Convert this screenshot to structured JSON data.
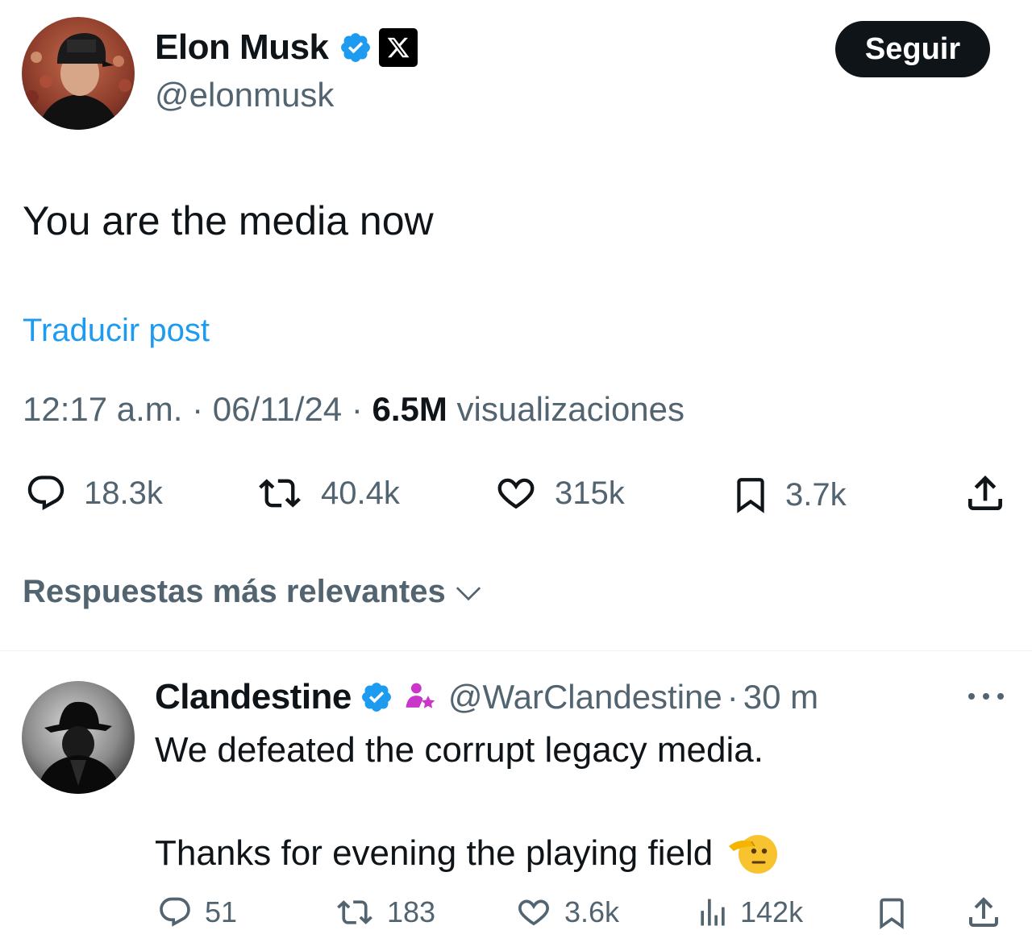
{
  "author": {
    "name": "Elon Musk",
    "handle": "@elonmusk",
    "verified": true,
    "affiliate_badge": "x-logo-icon"
  },
  "follow_button": {
    "label": "Seguir"
  },
  "post": {
    "text": "You are the media now",
    "translate_label": "Traducir post",
    "time": "12:17 a.m.",
    "date": "06/11/24",
    "views_count": "6.5M",
    "views_label": "visualizaciones"
  },
  "actions": {
    "replies": "18.3k",
    "reposts": "40.4k",
    "likes": "315k",
    "bookmarks": "3.7k"
  },
  "sort": {
    "label": "Respuestas más relevantes"
  },
  "reply": {
    "name": "Clandestine",
    "handle": "@WarClandestine",
    "time": "30 m",
    "verified": true,
    "line1": "We defeated the corrupt legacy media.",
    "line2": "Thanks for evening the playing field",
    "emoji": "saluting-face-icon",
    "actions": {
      "replies": "51",
      "reposts": "183",
      "likes": "3.6k",
      "views": "142k"
    }
  },
  "colors": {
    "text": "#0f1419",
    "secondary": "#536471",
    "accent_blue": "#1d9bf0",
    "button_bg": "#0f1419"
  }
}
